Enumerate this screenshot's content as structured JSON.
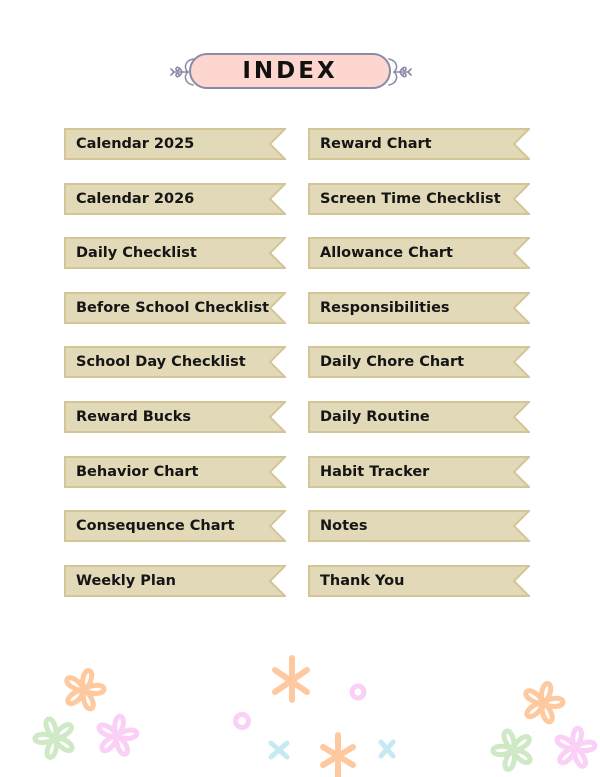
{
  "header": {
    "title": "INDEX"
  },
  "colors": {
    "title_fill": "#fdd6cf",
    "title_border": "#8a8aa6",
    "banner_fill": "#e2d9b8",
    "banner_border": "#d3c596",
    "text": "#151515",
    "flower_orange": "#ffc9a0",
    "flower_green": "#cfe8c6",
    "flower_pink": "#fbd0f7",
    "cross_blue": "#c7e9f3"
  },
  "index": {
    "left": [
      {
        "label": "Calendar 2025"
      },
      {
        "label": "Calendar 2026"
      },
      {
        "label": "Daily Checklist"
      },
      {
        "label": "Before School Checklist"
      },
      {
        "label": "School Day Checklist"
      },
      {
        "label": "Reward Bucks"
      },
      {
        "label": "Behavior Chart"
      },
      {
        "label": "Consequence Chart"
      },
      {
        "label": "Weekly Plan"
      }
    ],
    "right": [
      {
        "label": "Reward Chart"
      },
      {
        "label": "Screen Time Checklist"
      },
      {
        "label": "Allowance Chart"
      },
      {
        "label": "Responsibilities"
      },
      {
        "label": "Daily Chore Chart"
      },
      {
        "label": "Daily Routine"
      },
      {
        "label": "Habit Tracker"
      },
      {
        "label": "Notes"
      },
      {
        "label": "Thank You"
      }
    ]
  },
  "decorations": {
    "icons": [
      "flower-icon",
      "sparkle-icon",
      "circle-icon",
      "cross-icon"
    ]
  }
}
